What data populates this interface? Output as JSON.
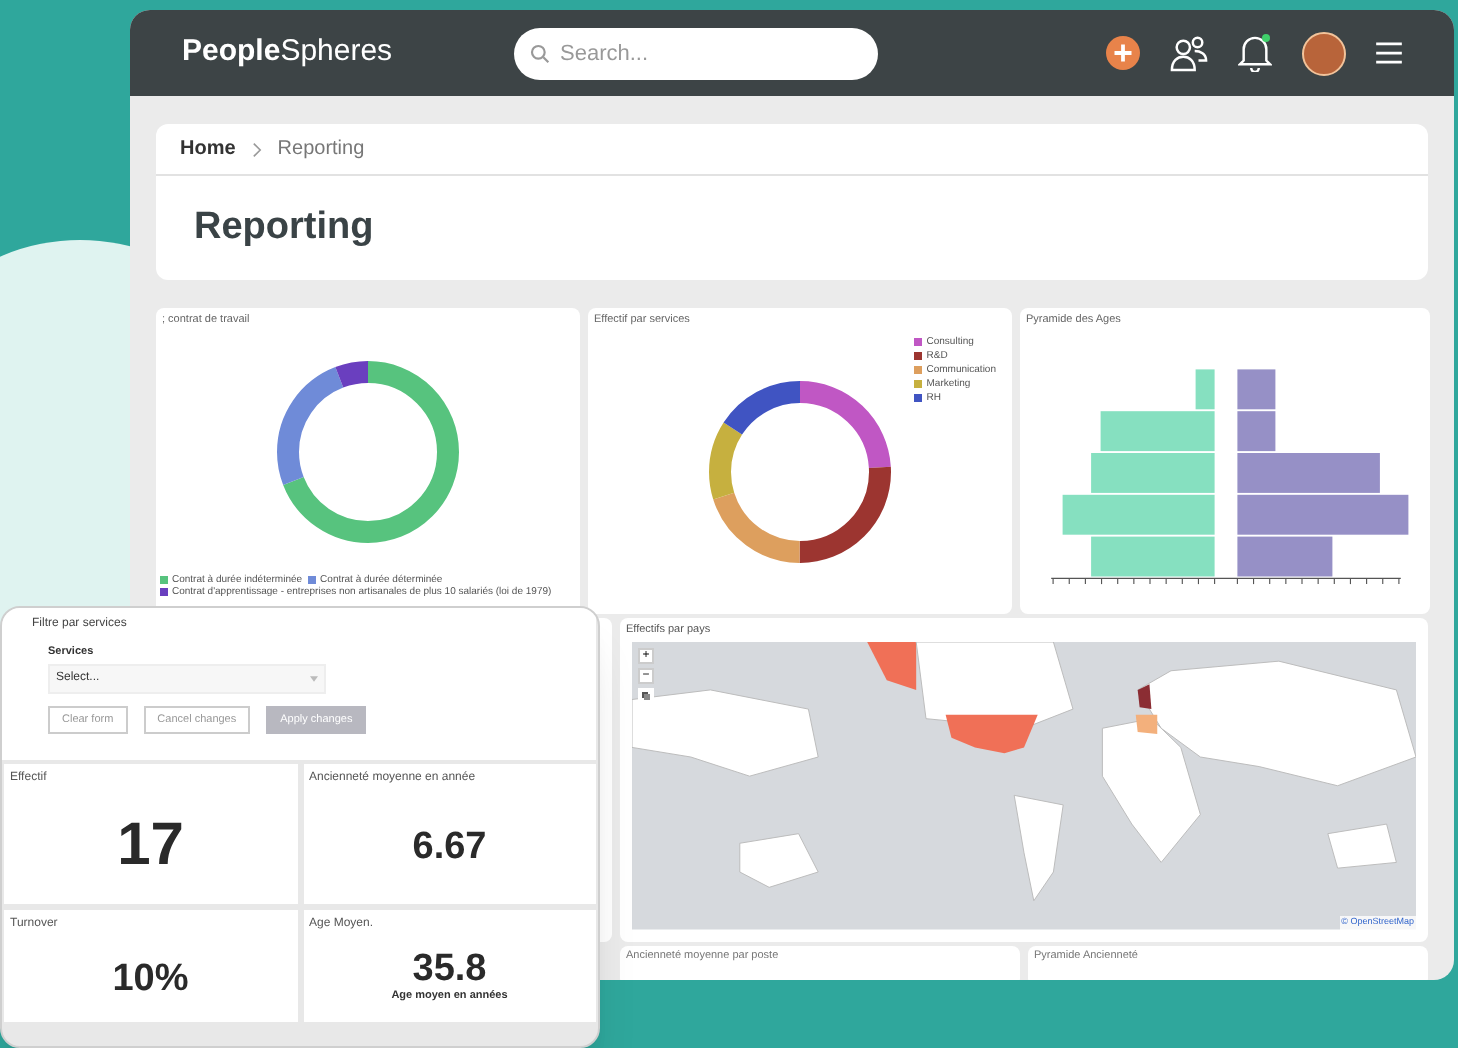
{
  "header": {
    "logo": "**People**Spheres",
    "search": {
      "placeholder": "Search..."
    },
    "notification_dot": true
  },
  "breadcrumb": [
    {
      "label": "Home",
      "current": false
    },
    {
      "label": "Reporting",
      "current": true
    }
  ],
  "page_title": "Reporting",
  "charts": [
    {
      "title": "; contrat de travail",
      "kind": "donut",
      "legend": [
        {
          "label": "Contrat à durée indéterminée",
          "color": "#57c37e"
        },
        {
          "label": "Contrat à durée déterminée",
          "color": "#6f8bd8"
        },
        {
          "label": "Contrat d'apprentissage - entreprises non artisanales de plus 10 salariés (loi de 1979)",
          "color": "#6a3fbf"
        }
      ]
    },
    {
      "title": "Effectif par services",
      "kind": "donut",
      "legend": [
        {
          "label": "Consulting",
          "color": "#c057c4"
        },
        {
          "label": "R&D",
          "color": "#9c3530"
        },
        {
          "label": "Communication",
          "color": "#dd9f5e"
        },
        {
          "label": "Marketing",
          "color": "#c6b03f"
        },
        {
          "label": "RH",
          "color": "#4054c2"
        }
      ]
    },
    {
      "title": "Pyramide des Ages",
      "kind": "pyramid"
    }
  ],
  "map": {
    "title": "Effectifs par pays",
    "zoom_in": "+",
    "zoom_out": "−",
    "attribution": "© OpenStreetMap"
  },
  "bottom_titles": [
    "Ancienneté moyenne par poste",
    "Pyramide Ancienneté"
  ],
  "filter": {
    "title": "Filtre par services",
    "field_label": "Services",
    "select_placeholder": "Select...",
    "buttons": [
      {
        "label": "Clear form",
        "disabled": false
      },
      {
        "label": "Cancel changes",
        "disabled": false
      },
      {
        "label": "Apply changes",
        "disabled": true
      }
    ]
  },
  "kpis": [
    {
      "title": "Effectif",
      "value": "17",
      "kind": "headline"
    },
    {
      "title": "Ancienneté moyenne en année",
      "value": "6.67",
      "kind": "value"
    },
    {
      "title": "Turnover",
      "value": "10%",
      "kind": "value"
    },
    {
      "title": "Age Moyen.",
      "value": "35.8",
      "kind": "value",
      "caption": "Age moyen en années"
    }
  ]
}
